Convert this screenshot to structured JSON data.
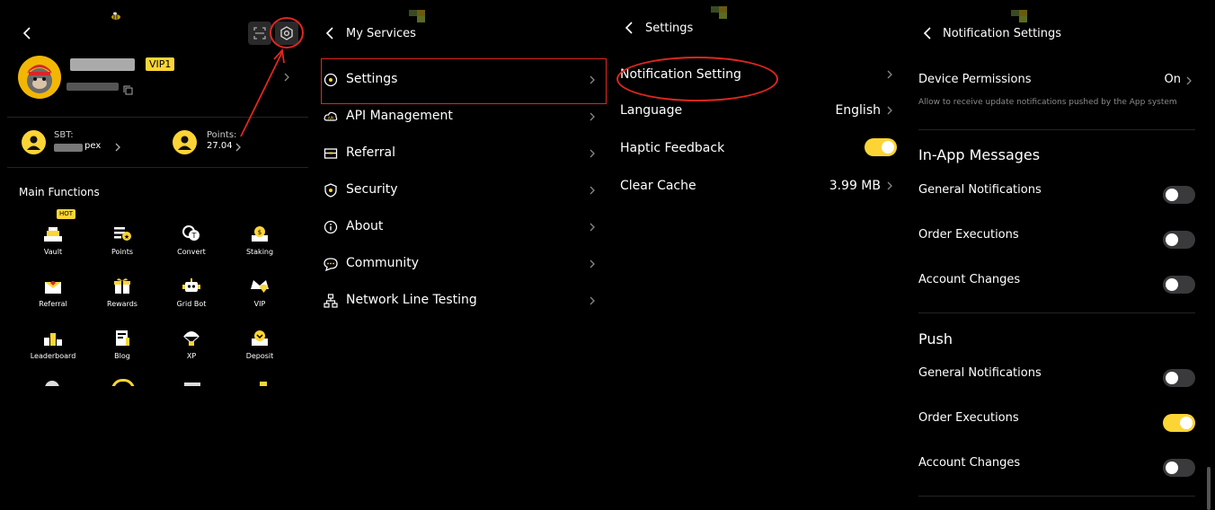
{
  "colors": {
    "accent": "#fcd535",
    "highlight_red": "#e0271f",
    "background": "#000000"
  },
  "profile": {
    "vip_badge": "VIP1",
    "sbt_label": "SBT:",
    "sbt_value": "pex",
    "points_label": "Points:",
    "points_value": "27.04",
    "main_functions_title": "Main Functions",
    "hot_badge": "HOT",
    "functions": [
      {
        "label": "Vault",
        "icon": "vault-icon"
      },
      {
        "label": "Points",
        "icon": "points-icon"
      },
      {
        "label": "Convert",
        "icon": "convert-icon"
      },
      {
        "label": "Staking",
        "icon": "staking-icon"
      },
      {
        "label": "Referral",
        "icon": "referral-icon"
      },
      {
        "label": "Rewards",
        "icon": "gift-icon"
      },
      {
        "label": "Grid Bot",
        "icon": "robot-icon"
      },
      {
        "label": "VIP",
        "icon": "crown-icon"
      },
      {
        "label": "Leaderboard",
        "icon": "podium-icon"
      },
      {
        "label": "Blog",
        "icon": "document-icon"
      },
      {
        "label": "XP",
        "icon": "parachute-icon"
      },
      {
        "label": "Deposit",
        "icon": "deposit-icon"
      }
    ]
  },
  "services": {
    "title": "My Services",
    "items": [
      {
        "label": "Settings",
        "icon": "gear-icon"
      },
      {
        "label": "API Management",
        "icon": "cloud-api-icon"
      },
      {
        "label": "Referral",
        "icon": "referral-icon"
      },
      {
        "label": "Security",
        "icon": "shield-icon"
      },
      {
        "label": "About",
        "icon": "info-icon"
      },
      {
        "label": "Community",
        "icon": "chat-icon"
      },
      {
        "label": "Network Line Testing",
        "icon": "network-icon"
      }
    ]
  },
  "settings": {
    "title": "Settings",
    "notification_label": "Notification Setting",
    "language_label": "Language",
    "language_value": "English",
    "haptic_label": "Haptic Feedback",
    "haptic_on": true,
    "cache_label": "Clear Cache",
    "cache_value": "3.99 MB"
  },
  "notifications": {
    "title": "Notification Settings",
    "device_permissions_label": "Device Permissions",
    "device_permissions_value": "On",
    "device_permissions_desc": "Allow to receive update notifications pushed by the App system",
    "inapp_title": "In-App Messages",
    "inapp": [
      {
        "label": "General Notifications",
        "on": false
      },
      {
        "label": "Order Executions",
        "on": false
      },
      {
        "label": "Account Changes",
        "on": false
      }
    ],
    "push_title": "Push",
    "push": [
      {
        "label": "General Notifications",
        "on": false
      },
      {
        "label": "Order Executions",
        "on": true
      },
      {
        "label": "Account Changes",
        "on": false
      }
    ]
  }
}
